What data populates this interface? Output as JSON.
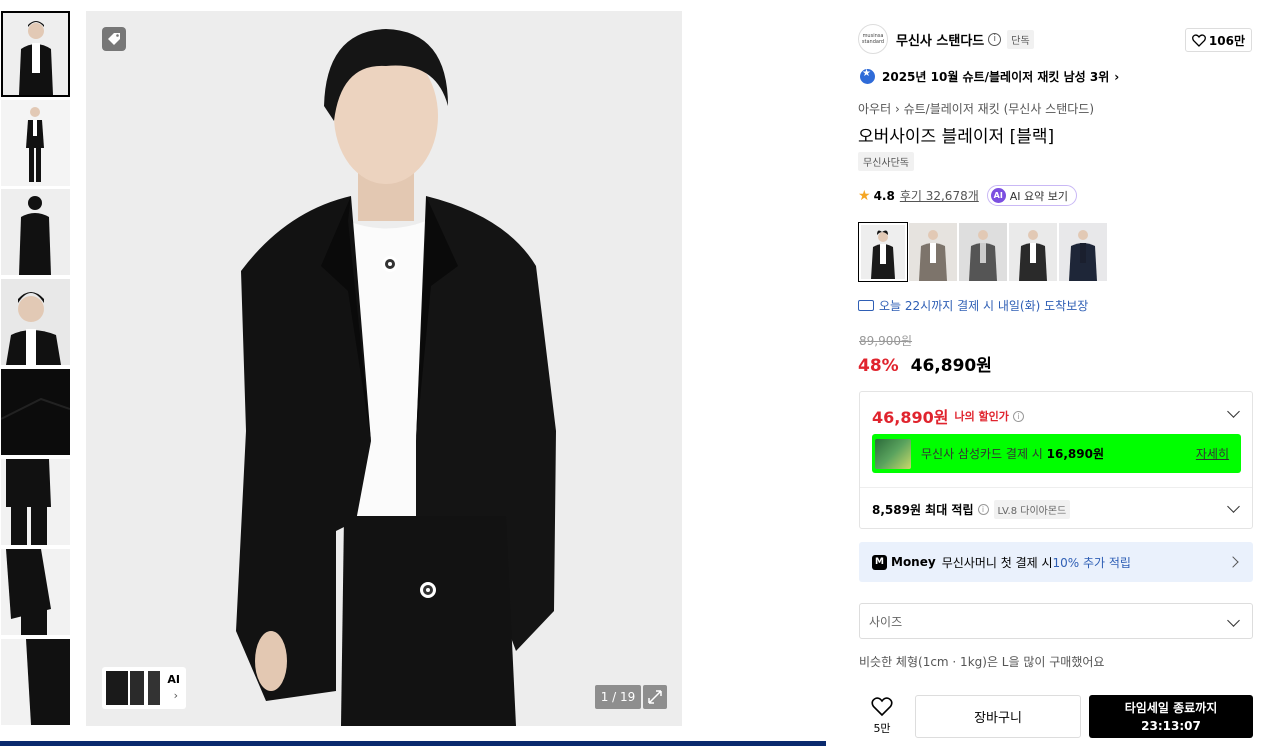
{
  "gallery": {
    "counter": "1 / 19",
    "ai_label": "AI",
    "thumbnail_count": 8
  },
  "brand": {
    "logo_text": "musinsa standard",
    "name": "무신사 스탠다드",
    "badge": "단독",
    "likes": "106만"
  },
  "ranking": {
    "text": "2025년 10월 슈트/블레이저 재킷 남성 3위"
  },
  "breadcrumb": {
    "level1": "아우터",
    "level2": "슈트/블레이저 재킷 (무신사 스탠다드)"
  },
  "product": {
    "title": "오버사이즈 블레이저 [블랙]",
    "tag": "무신사단독",
    "rating": "4.8",
    "reviews": "후기 32,678개",
    "ai_summary": "AI 요약 보기",
    "ai_icon": "AI"
  },
  "colors": {
    "swatches": [
      "#1a1a1a",
      "#7d746b",
      "#555555",
      "#2a2a2a",
      "#1e2638"
    ]
  },
  "delivery": {
    "text": "오늘 22시까지 결제 시 내일(화) 도착보장"
  },
  "price": {
    "original": "89,900원",
    "discount": "48%",
    "sale": "46,890원"
  },
  "benefits": {
    "my_price": "46,890원",
    "my_price_label": "나의 할인가",
    "card_text": "무신사 삼성카드 결제 시 ",
    "card_amount": "16,890원",
    "card_more": "자세히",
    "points": "8,589원 최대 적립",
    "level": "LV.8 다이아몬드"
  },
  "money": {
    "logo": "M",
    "brand": "Money",
    "text": "무신사머니 첫 결제 시 ",
    "highlight": "10% 추가 적립"
  },
  "size": {
    "placeholder": "사이즈",
    "hint": "비슷한 체형(1cm · 1kg)은 L을 많이 구매했어요"
  },
  "actions": {
    "wish_count": "5만",
    "cart": "장바구니",
    "buy_line1": "타임세일 종료까지",
    "buy_line2": "23:13:07"
  }
}
